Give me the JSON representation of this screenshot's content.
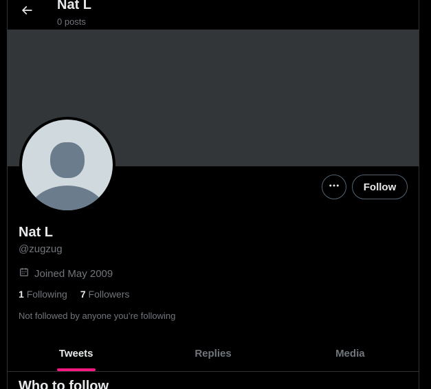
{
  "header": {
    "title": "Nat L",
    "post_count": "0 posts",
    "back_icon": "arrow-left-icon"
  },
  "profile": {
    "name": "Nat L",
    "handle": "@zugzug",
    "joined": "Joined May 2009",
    "joined_icon": "calendar-icon",
    "following_count": "1",
    "following_label": "Following",
    "followers_count": "7",
    "followers_label": "Followers",
    "mutuals_text": "Not followed by anyone you’re following"
  },
  "actions": {
    "more_icon": "ellipsis-icon",
    "follow_label": "Follow"
  },
  "tabs": [
    {
      "label": "Tweets",
      "active": true
    },
    {
      "label": "Replies",
      "active": false
    },
    {
      "label": "Media",
      "active": false
    }
  ],
  "sidebar_section": {
    "title": "Who to follow"
  },
  "colors": {
    "background": "#000000",
    "banner": "#333639",
    "avatar_bg": "#cfd9de",
    "avatar_figure": "#6b7c8c",
    "accent_underline": "#f91880",
    "secondary_text": "#71767b",
    "primary_text": "#e7e9ea",
    "border": "#2f3336"
  }
}
